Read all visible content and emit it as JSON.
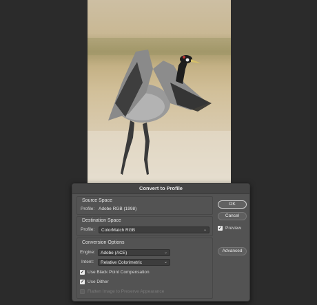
{
  "dialog": {
    "title": "Convert to Profile",
    "source_space": {
      "heading": "Source Space",
      "profile_label": "Profile:",
      "profile_value": "Adobe RGB (1998)"
    },
    "destination_space": {
      "heading": "Destination Space",
      "profile_label": "Profile:",
      "profile_value": "ColorMatch RGB"
    },
    "conversion_options": {
      "heading": "Conversion Options",
      "engine_label": "Engine:",
      "engine_value": "Adobe (ACE)",
      "intent_label": "Intent:",
      "intent_value": "Relative Colorimetric",
      "black_point_label": "Use Black Point Compensation",
      "black_point_checked": true,
      "dither_label": "Use Dither",
      "dither_checked": true,
      "flatten_label": "Flatten Image to Preserve Appearance",
      "flatten_checked": false
    },
    "buttons": {
      "ok": "OK",
      "cancel": "Cancel",
      "preview_label": "Preview",
      "preview_checked": true,
      "advanced": "Advanced"
    }
  },
  "colors": {
    "canvas_background": "#2b2b2b",
    "dialog_background": "#535353"
  },
  "icons": {
    "chevron": "chevron-down-icon",
    "check": "checkmark-icon"
  }
}
